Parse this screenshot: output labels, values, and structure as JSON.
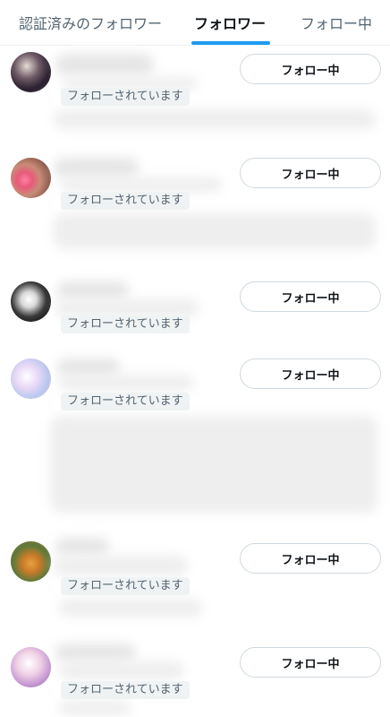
{
  "tabs": [
    {
      "label": "認証済みのフォロワー",
      "active": false
    },
    {
      "label": "フォロワー",
      "active": true
    },
    {
      "label": "フォロー中",
      "active": false
    }
  ],
  "accent_color": "#1d9bf0",
  "users": [
    {
      "follows_you_label": "フォローされています",
      "follow_button_label": "フォロー中"
    },
    {
      "follows_you_label": "フォローされています",
      "follow_button_label": "フォロー中"
    },
    {
      "follows_you_label": "フォローされています",
      "follow_button_label": "フォロー中"
    },
    {
      "follows_you_label": "フォローされています",
      "follow_button_label": "フォロー中"
    },
    {
      "follows_you_label": "フォローされています",
      "follow_button_label": "フォロー中"
    },
    {
      "follows_you_label": "フォローされています",
      "follow_button_label": "フォロー中"
    }
  ]
}
